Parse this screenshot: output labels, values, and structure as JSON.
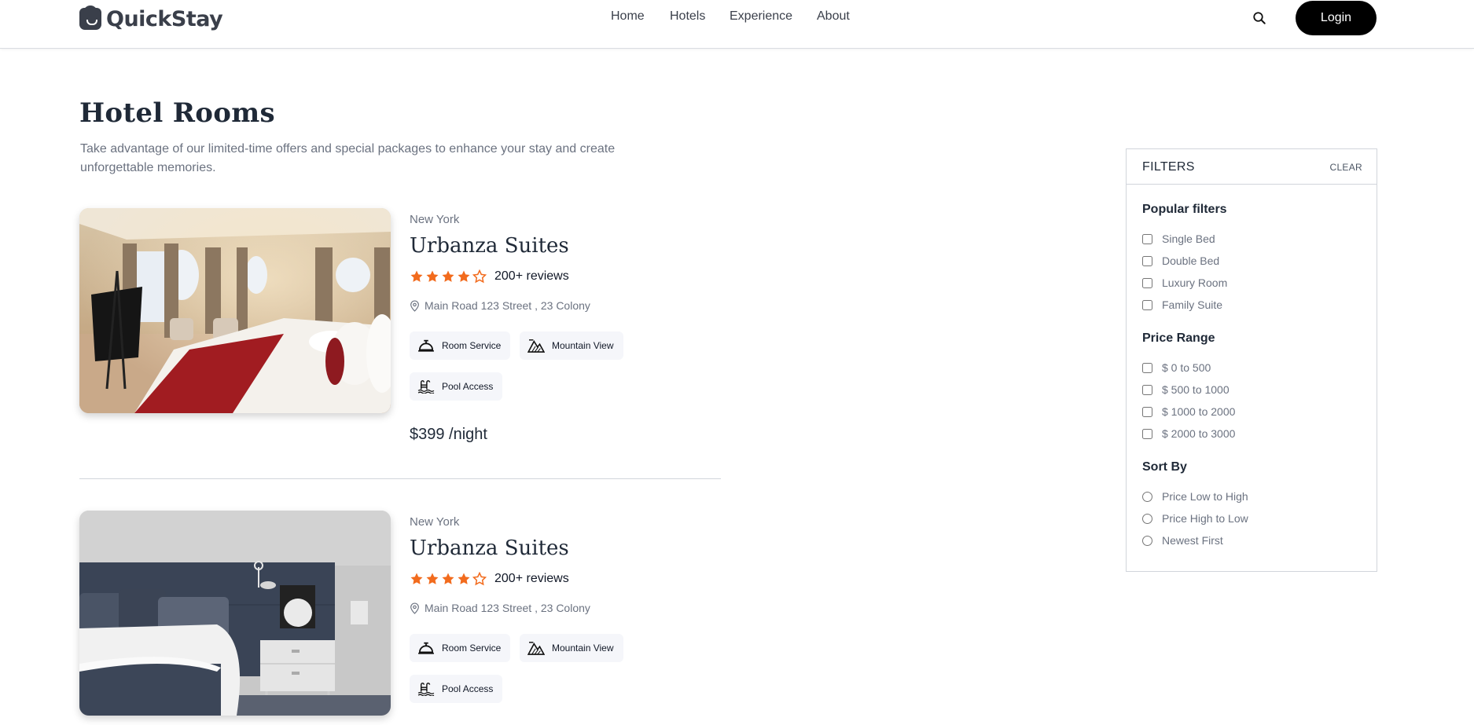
{
  "brand": {
    "name": "QuickStay"
  },
  "nav": {
    "home": "Home",
    "hotels": "Hotels",
    "experience": "Experience",
    "about": "About",
    "login": "Login"
  },
  "header": {
    "title": "Hotel Rooms",
    "subtitle": "Take advantage of our limited-time offers and special packages to enhance your stay and create unforgettable memories."
  },
  "rooms": [
    {
      "city": "New York",
      "name": "Urbanza Suites",
      "rating": 4,
      "reviews": "200+ reviews",
      "address": "Main Road 123 Street , 23 Colony",
      "amenities": [
        "Room Service",
        "Mountain View",
        "Pool Access"
      ],
      "price": "$399 /night"
    },
    {
      "city": "New York",
      "name": "Urbanza Suites",
      "rating": 4,
      "reviews": "200+ reviews",
      "address": "Main Road 123 Street , 23 Colony",
      "amenities": [
        "Room Service",
        "Mountain View",
        "Pool Access"
      ]
    }
  ],
  "filters": {
    "title": "FILTERS",
    "clear": "CLEAR",
    "popular": {
      "title": "Popular filters",
      "options": [
        "Single Bed",
        "Double Bed",
        "Luxury Room",
        "Family Suite"
      ]
    },
    "price": {
      "title": "Price Range",
      "options": [
        "$ 0 to 500",
        "$ 500 to 1000",
        "$ 1000 to 2000",
        "$ 2000 to 3000"
      ]
    },
    "sort": {
      "title": "Sort By",
      "options": [
        "Price Low to High",
        "Price High to Low",
        "Newest First"
      ]
    }
  },
  "colors": {
    "star": "#f26b1d",
    "button": "#000000",
    "accent_text": "#1f2937"
  }
}
